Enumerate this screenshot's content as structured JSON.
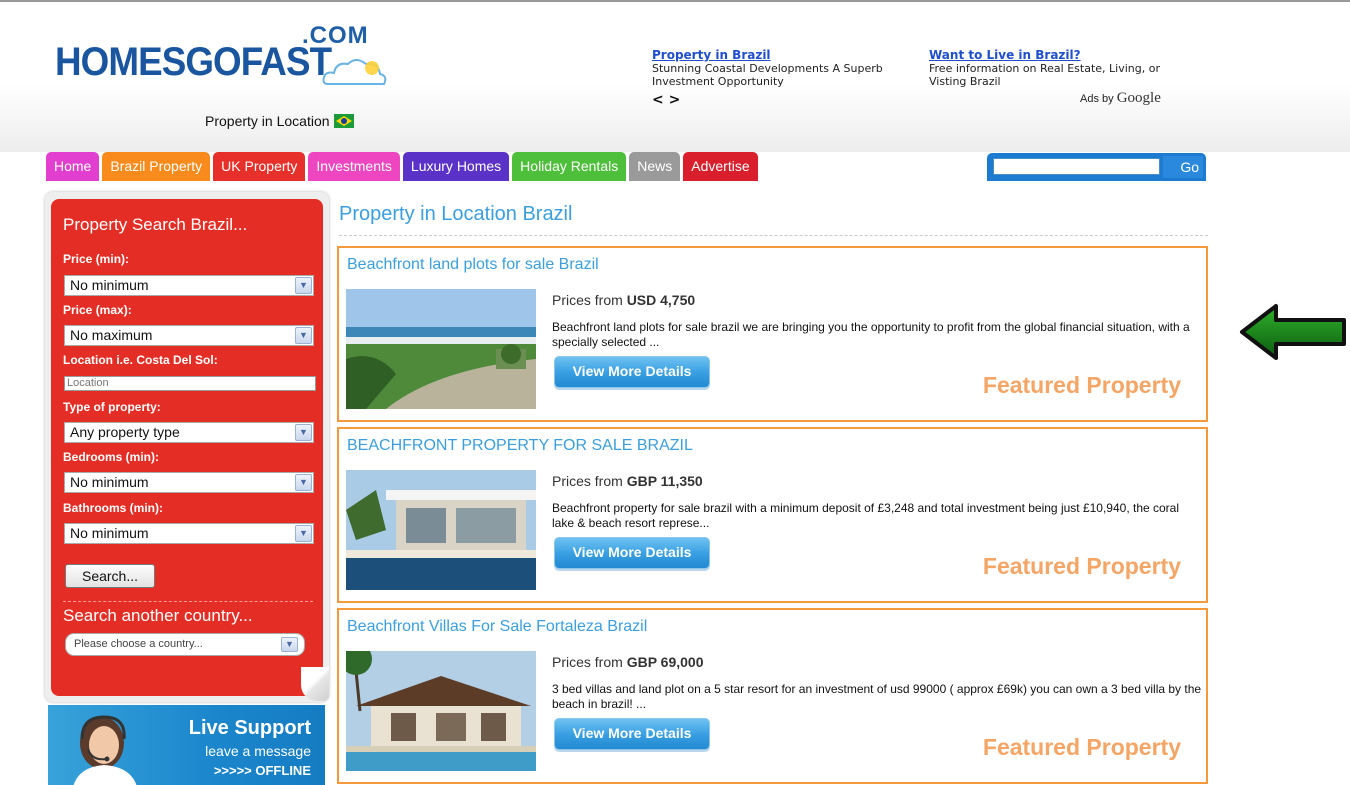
{
  "header": {
    "logo_main": "HOMESGOFAST",
    "logo_com": ".COM",
    "tagline": "Property in Location",
    "ads": [
      {
        "title": "Property in Brazil",
        "text": "Stunning Coastal Developments A Superb Investment Opportunity",
        "nav": "< >"
      },
      {
        "title": "Want to Live in Brazil?",
        "text": "Free information on Real Estate, Living, or Visting Brazil"
      }
    ],
    "ads_by_label": "Ads by",
    "ads_by_brand": "Google"
  },
  "nav": {
    "tabs": [
      {
        "label": "Home",
        "color": "#e23fd0"
      },
      {
        "label": "Brazil Property",
        "color": "#f98a1c"
      },
      {
        "label": "UK Property",
        "color": "#e8302a"
      },
      {
        "label": "Investments",
        "color": "#ee46c1"
      },
      {
        "label": "Luxury Homes",
        "color": "#5a32c8"
      },
      {
        "label": "Holiday Rentals",
        "color": "#4ebf3a"
      },
      {
        "label": "News",
        "color": "#9a9a9a"
      },
      {
        "label": "Advertise",
        "color": "#d91f2b"
      }
    ],
    "search_value": "",
    "search_go": "Go"
  },
  "sidebar": {
    "title": "Property Search Brazil...",
    "price_min_label": "Price (min):",
    "price_min_value": "No minimum",
    "price_max_label": "Price (max):",
    "price_max_value": "No maximum",
    "location_label": "Location i.e. Costa Del Sol:",
    "location_placeholder": "Location",
    "type_label": "Type of property:",
    "type_value": "Any property type",
    "bedrooms_label": "Bedrooms (min):",
    "bedrooms_value": "No minimum",
    "bathrooms_label": "Bathrooms (min):",
    "bathrooms_value": "No minimum",
    "search_button": "Search...",
    "country_title": "Search another country...",
    "country_value": "Please choose a country..."
  },
  "live_support": {
    "title": "Live Support",
    "subtitle": "leave a message",
    "status": ">>>>> OFFLINE"
  },
  "main": {
    "title": "Property in Location Brazil",
    "listings": [
      {
        "title": "Beachfront land plots for sale Brazil",
        "price_prefix": "Prices from",
        "price": "USD 4,750",
        "description": "Beachfront land plots for sale brazil we are bringing you the opportunity to profit from the global financial situation, with a specially selected ...",
        "button": "View More Details",
        "badge": "Featured Property"
      },
      {
        "title": "BEACHFRONT PROPERTY FOR SALE BRAZIL",
        "price_prefix": "Prices from",
        "price": "GBP 11,350",
        "description": "Beachfront property for sale brazil with a minimum deposit of £3,248 and total investment being just £10,940, the coral lake & beach resort represe...",
        "button": "View More Details",
        "badge": "Featured Property"
      },
      {
        "title": "Beachfront Villas For Sale Fortaleza Brazil",
        "price_prefix": "Prices from",
        "price": "GBP 69,000",
        "description": "3 bed villas and land plot on a 5 star resort for an investment of usd 99000 ( approx £69k) you can own a 3 bed villa by the beach in brazil! ...",
        "button": "View More Details",
        "badge": "Featured Property"
      }
    ]
  },
  "icons": {
    "flag": "brazil-flag-icon",
    "arrow": "green-arrow-icon",
    "dropdown": "chevron-down-icon"
  }
}
